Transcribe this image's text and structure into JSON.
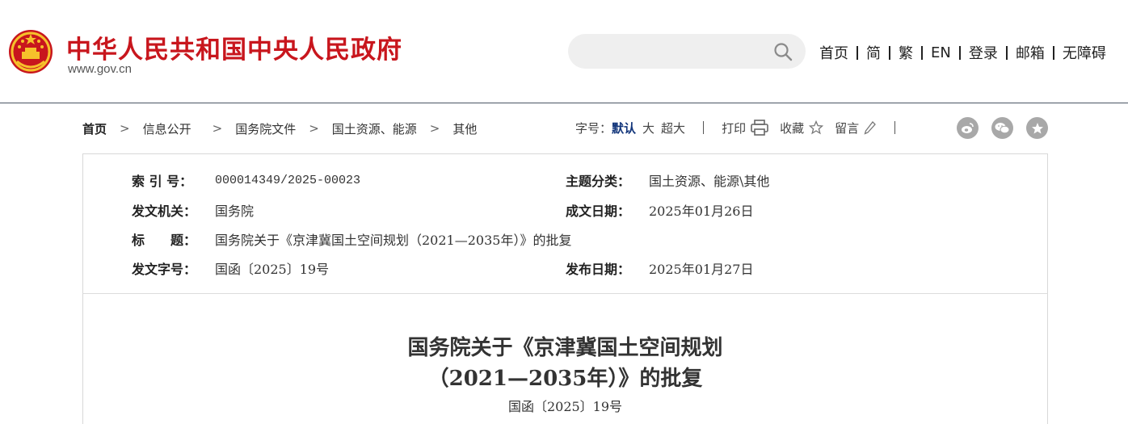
{
  "header": {
    "site_title": "中华人民共和国中央人民政府",
    "site_url": "www.gov.cn",
    "search_placeholder": "",
    "nav": [
      "首页",
      "简",
      "繁",
      "EN",
      "登录",
      "邮箱",
      "无障碍"
    ]
  },
  "breadcrumb": [
    "首页",
    "信息公开",
    "国务院文件",
    "国土资源、能源",
    "其他"
  ],
  "tools": {
    "font_size_label": "字号：",
    "font_default": "默认",
    "font_large": "大",
    "font_xlarge": "超大",
    "print": "打印",
    "favorite": "收藏",
    "comment": "留言"
  },
  "info": {
    "index_label": "索 引 号：",
    "index_value": "000014349/2025-00023",
    "category_label": "主题分类：",
    "category_value": "国土资源、能源\\其他",
    "issuer_label": "发文机关：",
    "issuer_value": "国务院",
    "written_date_label": "成文日期：",
    "written_date_value": "2025年01月26日",
    "title_label": "标　　题：",
    "title_value": "国务院关于《京津冀国土空间规划（2021—2035年）》的批复",
    "docno_label": "发文字号：",
    "docno_value": "国函〔2025〕19号",
    "publish_date_label": "发布日期：",
    "publish_date_value": "2025年01月27日"
  },
  "article": {
    "title_line1": "国务院关于《京津冀国土空间规划",
    "title_line2": "（2021—2035年）》的批复",
    "doc_number": "国函〔2025〕19号"
  },
  "colors": {
    "brand_red": "#c8161d",
    "active_blue": "#13367b",
    "share_gray": "#a8a8a8"
  }
}
